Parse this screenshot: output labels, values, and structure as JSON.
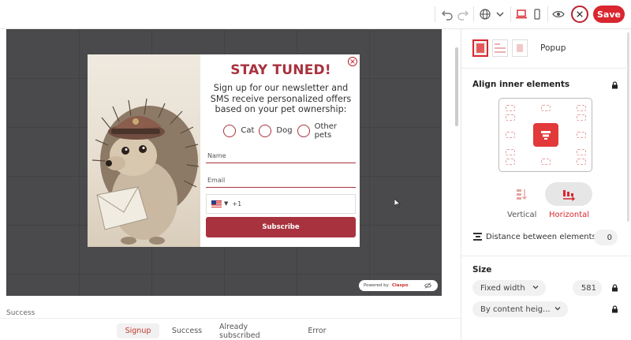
{
  "toolbar": {
    "icons": [
      "undo-icon",
      "redo-icon",
      "globe-icon",
      "chevron-down-icon",
      "desktop-icon",
      "mobile-icon",
      "preview-eye-icon",
      "close-icon"
    ],
    "save_label": "Save",
    "accent": "#d9262f"
  },
  "popup": {
    "title": "STAY TUNED!",
    "description": "Sign up for our newsletter and SMS receive personalized offers based on your pet ownership:",
    "options": [
      "Cat",
      "Dog",
      "Other pets"
    ],
    "name_placeholder": "Name",
    "email_placeholder": "Email",
    "phone_code": "+1",
    "subscribe_label": "Subscribe",
    "brand_color": "#a8323e",
    "powered_by": "Powered by",
    "powered_brand": "Claspo"
  },
  "canvas": {
    "background": "#4a4a4d"
  },
  "bottom": {
    "current_state_label": "Success",
    "tabs": [
      "Signup",
      "Success",
      "Already subscribed",
      "Error"
    ],
    "active_tab": "Signup"
  },
  "panel": {
    "layout_label": "Popup",
    "align_title": "Align inner elements",
    "direction_vertical": "Vertical",
    "direction_horizontal": "Horizontal",
    "active_direction": "Horizontal",
    "distance_label": "Distance between elements",
    "distance_value": "0",
    "size_title": "Size",
    "width_mode": "Fixed width",
    "width_value": "581",
    "height_mode": "By content heig..."
  }
}
